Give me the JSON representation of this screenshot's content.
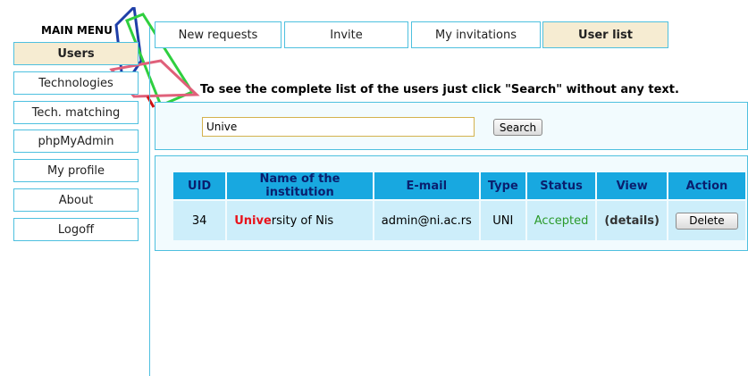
{
  "menu": {
    "title": "MAIN MENU",
    "items": [
      {
        "label": "Users",
        "active": true
      },
      {
        "label": "Technologies"
      },
      {
        "label": "Tech. matching"
      },
      {
        "label": "phpMyAdmin"
      },
      {
        "label": "My profile"
      },
      {
        "label": "About"
      },
      {
        "label": "Logoff"
      }
    ]
  },
  "tabs": [
    {
      "label": "New requests"
    },
    {
      "label": "Invite"
    },
    {
      "label": "My invitations"
    },
    {
      "label": "User list",
      "active": true
    }
  ],
  "hint": "To see the complete list of the users just click \"Search\" without any text.",
  "search": {
    "value": "Unive",
    "button_label": "Search"
  },
  "table": {
    "headers": [
      "UID",
      "Name of the institution",
      "E-mail",
      "Type",
      "Status",
      "View",
      "Action"
    ],
    "rows": [
      {
        "uid": "34",
        "name_match": "Unive",
        "name_rest": "rsity of Nis",
        "email": "admin@ni.ac.rs",
        "type": "UNI",
        "status": "Accepted",
        "view": "(details)",
        "action": "Delete"
      }
    ]
  },
  "colors": {
    "accent": "#4ec0df",
    "header_bg": "#18a8e0",
    "active_bg": "#f6ecd2",
    "match": "#e8141c",
    "accepted": "#2b9a2b"
  }
}
